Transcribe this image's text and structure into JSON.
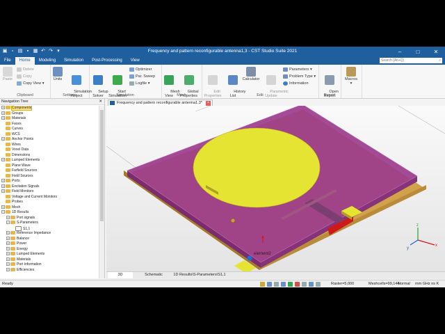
{
  "titlebar": {
    "title": "Frequency  and pattern reconfigurable antenna1,3 - CST Studio Suite 2021",
    "quick_access": [
      "app-icon",
      "new-icon",
      "open-icon",
      "save-icon",
      "save-all-icon",
      "undo-icon",
      "redo-icon",
      "customize-icon"
    ],
    "minimize": "–",
    "maximize": "□",
    "close": "✕"
  },
  "menu": {
    "tabs": [
      "File",
      "Home",
      "Modeling",
      "Simulation",
      "Post-Processing",
      "View"
    ],
    "active": "Home",
    "search_placeholder": "Search (Alt+Q)"
  },
  "ribbon": {
    "clipboard": {
      "label": "Clipboard",
      "paste": "Paste",
      "delete": "Delete",
      "copy": "Copy",
      "copy_view": "Copy View"
    },
    "settings": {
      "label": "Settings",
      "units": "Units",
      "simulation_project": "Simulation\nProject"
    },
    "simulation": {
      "label": "Simulation",
      "setup_solver": "Setup\nSolver",
      "start_simulation": "Start\nSimulation",
      "optimizer": "Optimizer",
      "par_sweep": "Par. Sweep",
      "logfile": "Logfile"
    },
    "mesh": {
      "label": "Mesh",
      "mesh_view": "Mesh\nView",
      "global_properties": "Global\nProperties"
    },
    "edit": {
      "label": "Edit",
      "edit_properties": "Edit\nProperties",
      "history_list": "History\nList",
      "calculator": "Calculator",
      "parametric_update": "Parametric\nUpdate",
      "parameters": "Parameters",
      "problem_type": "Problem Type",
      "information": "Information"
    },
    "report": {
      "label": "Report",
      "open_report": "Open\nReport"
    },
    "macros": {
      "label": "",
      "macros": "Macros"
    }
  },
  "navigation_tree": {
    "title": "Navigation Tree",
    "close": "✕",
    "items": [
      {
        "label": "Components",
        "level": 0,
        "toggle": "+",
        "selected": true
      },
      {
        "label": "Groups",
        "level": 0,
        "toggle": "+"
      },
      {
        "label": "Materials",
        "level": 0,
        "toggle": "+"
      },
      {
        "label": "Faces",
        "level": 0,
        "toggle": ""
      },
      {
        "label": "Curves",
        "level": 0,
        "toggle": ""
      },
      {
        "label": "WCS",
        "level": 0,
        "toggle": ""
      },
      {
        "label": "Anchor Points",
        "level": 0,
        "toggle": "+"
      },
      {
        "label": "Wires",
        "level": 0,
        "toggle": ""
      },
      {
        "label": "Voxel Data",
        "level": 0,
        "toggle": ""
      },
      {
        "label": "Dimensions",
        "level": 0,
        "toggle": ""
      },
      {
        "label": "Lumped Elements",
        "level": 0,
        "toggle": "+"
      },
      {
        "label": "Plane Wave",
        "level": 0,
        "toggle": ""
      },
      {
        "label": "Farfield Sources",
        "level": 0,
        "toggle": ""
      },
      {
        "label": "Field Sources",
        "level": 0,
        "toggle": ""
      },
      {
        "label": "Ports",
        "level": 0,
        "toggle": "+"
      },
      {
        "label": "Excitation Signals",
        "level": 0,
        "toggle": "+"
      },
      {
        "label": "Field Monitors",
        "level": 0,
        "toggle": "+"
      },
      {
        "label": "Voltage and Current Monitors",
        "level": 0,
        "toggle": ""
      },
      {
        "label": "Probes",
        "level": 0,
        "toggle": ""
      },
      {
        "label": "Mesh",
        "level": 0,
        "toggle": "+"
      },
      {
        "label": "1D Results",
        "level": 0,
        "toggle": "−"
      },
      {
        "label": "Port signals",
        "level": 1,
        "toggle": "+"
      },
      {
        "label": "S-Parameters",
        "level": 1,
        "toggle": "−"
      },
      {
        "label": "S1,1",
        "level": 2,
        "toggle": "",
        "leaf": true
      },
      {
        "label": "Reference Impedance",
        "level": 1,
        "toggle": "+"
      },
      {
        "label": "Balance",
        "level": 1,
        "toggle": "+"
      },
      {
        "label": "Power",
        "level": 1,
        "toggle": "+"
      },
      {
        "label": "Energy",
        "level": 1,
        "toggle": "+"
      },
      {
        "label": "Lumped Elements",
        "level": 1,
        "toggle": "+"
      },
      {
        "label": "Materials",
        "level": 1,
        "toggle": "+"
      },
      {
        "label": "Port Information",
        "level": 1,
        "toggle": "+"
      },
      {
        "label": "Efficiencies",
        "level": 1,
        "toggle": "+"
      }
    ]
  },
  "document_tab": {
    "label": "Frequency  and pattern reconfigurable antenna1,3*",
    "icon": "cst-icon"
  },
  "viewport": {
    "label_element": "element2"
  },
  "bottom_tabs": [
    "3D",
    "Schematic",
    "1D Results\\S-Parameters\\S1,1"
  ],
  "status": {
    "left": "Ready",
    "raster": "Raster=5.000",
    "meshcells": "Meshcells=99,144",
    "normal": "Normal",
    "units": "mm  GHz  ns  K"
  },
  "colors": {
    "title_blue": "#1f5f9e",
    "substrate_purple": "#9c3c8c",
    "patch_yellow": "#e6e433",
    "ground_copper": "#d2a24a",
    "port_red": "#cc1a1a"
  }
}
